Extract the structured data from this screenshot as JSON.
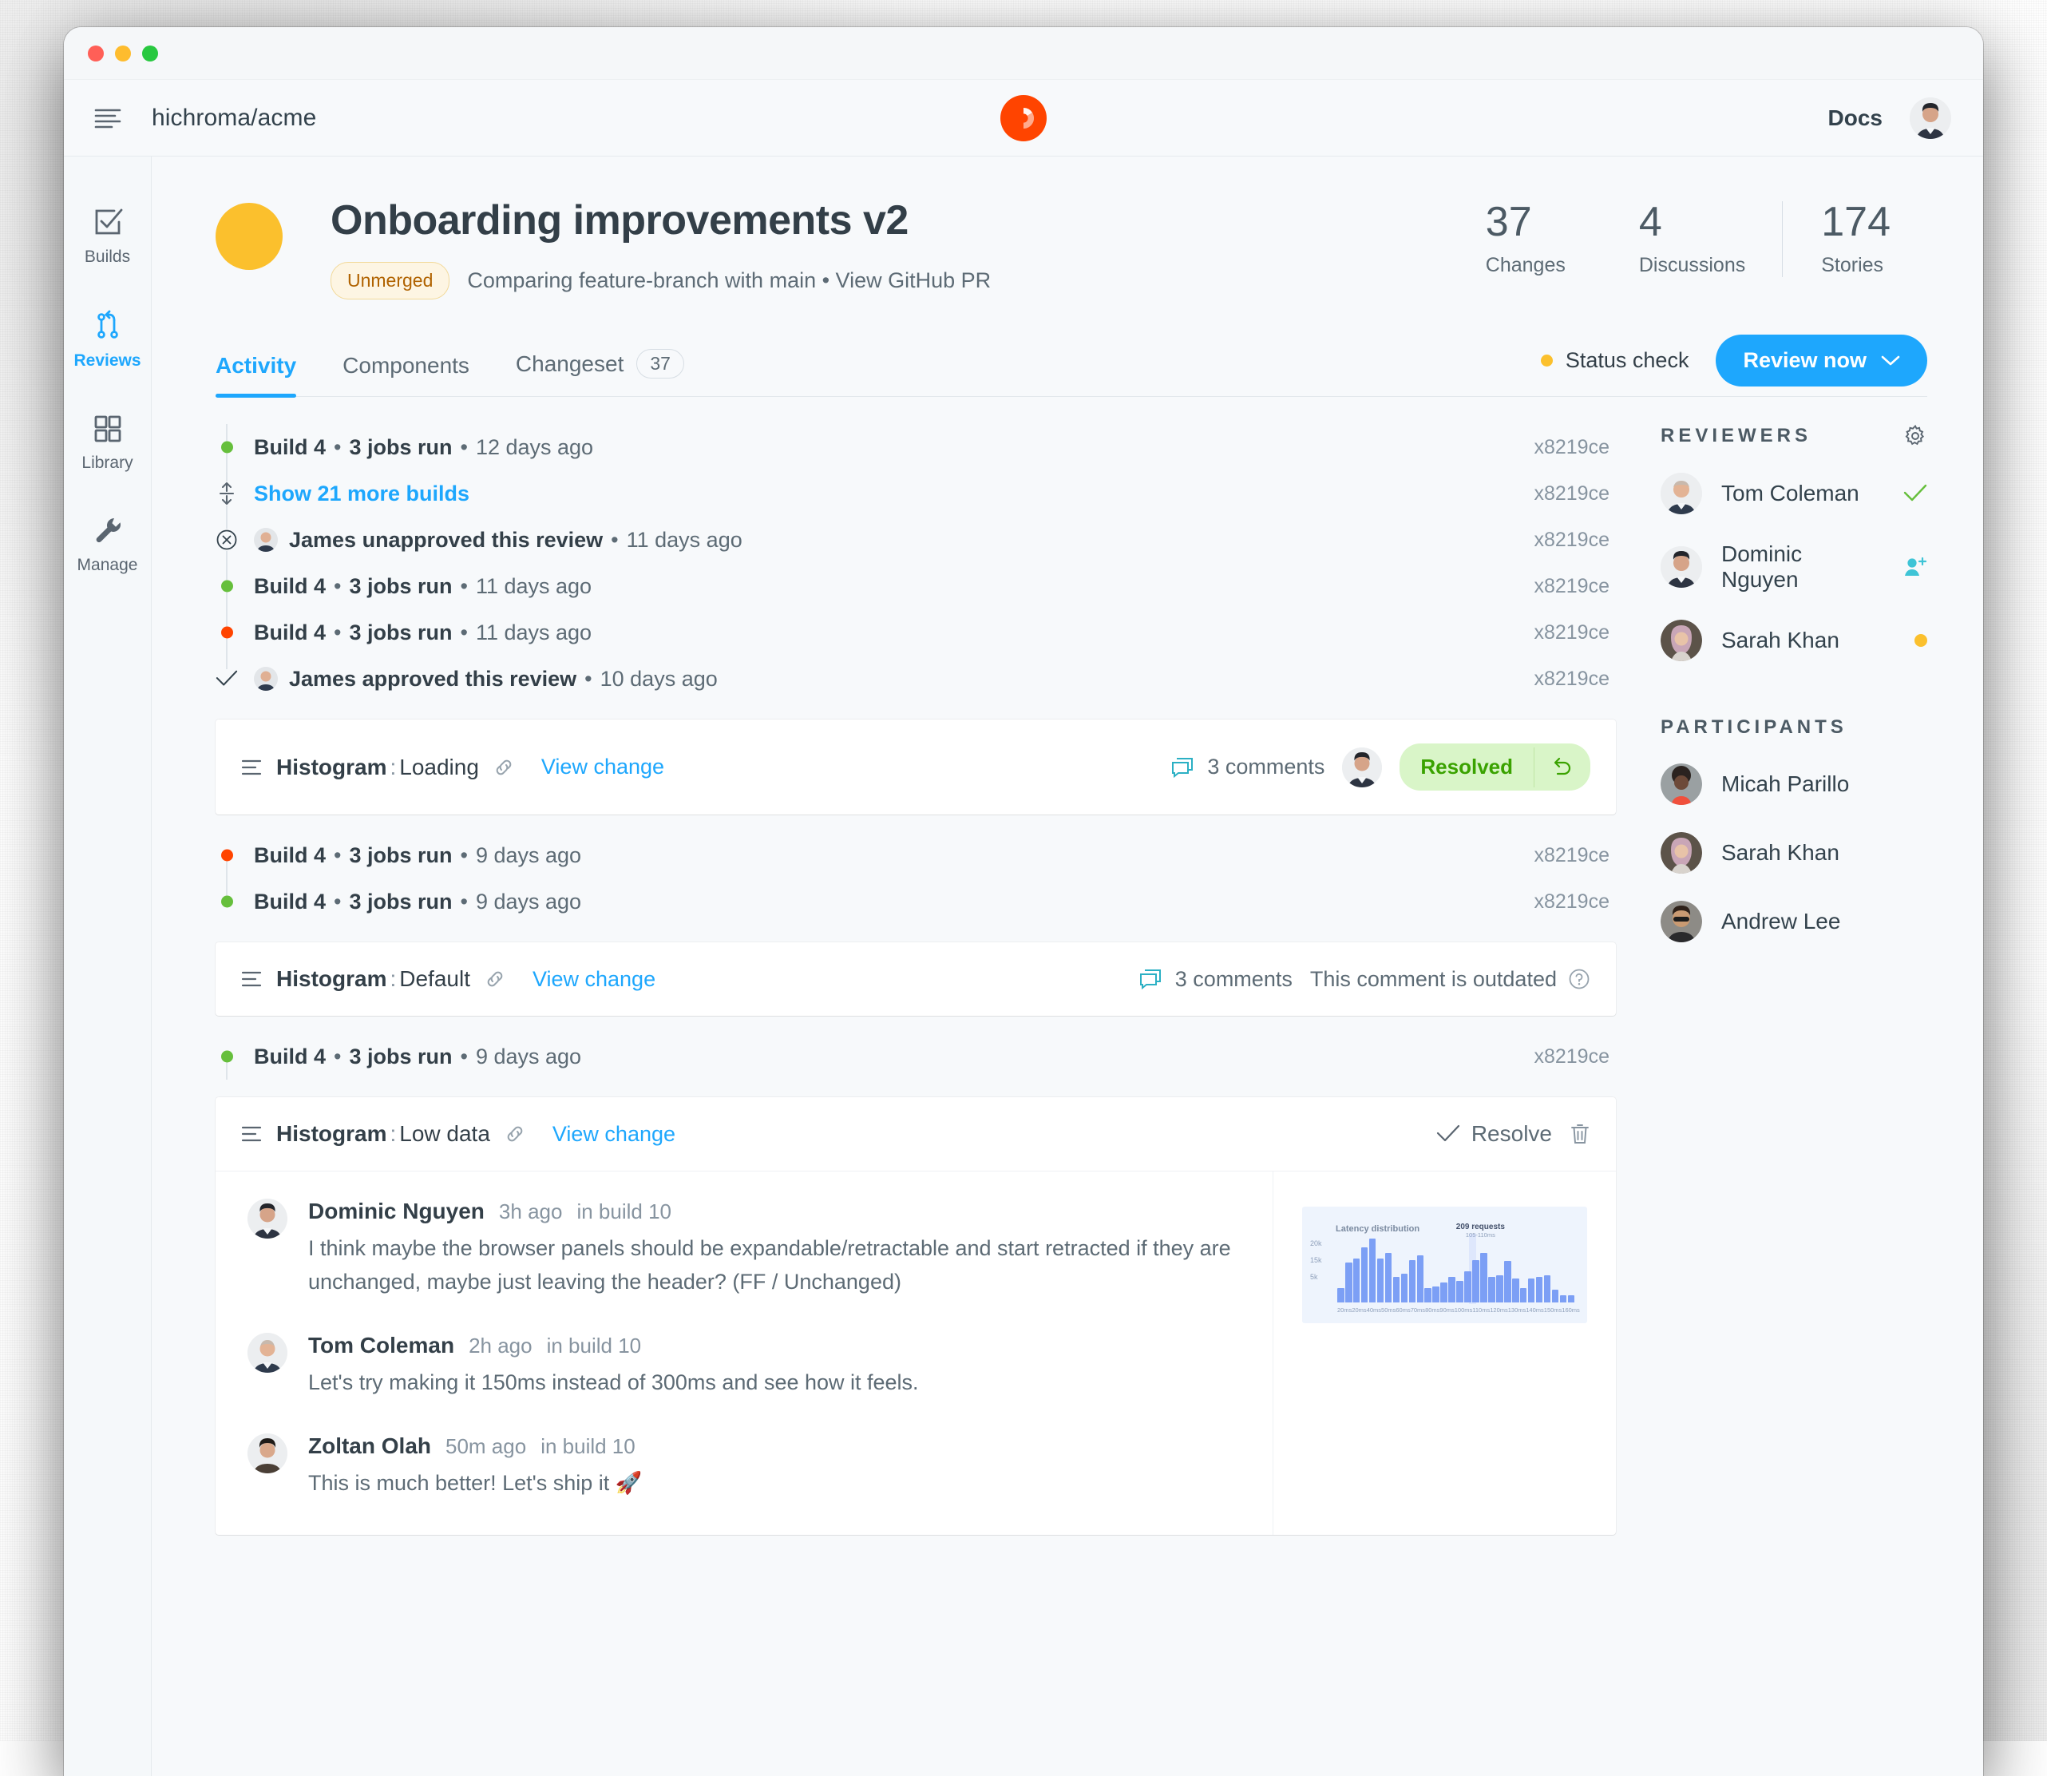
{
  "topnav": {
    "menu_icon": "hamburger-icon",
    "repo": "hichroma/acme",
    "logo": "chromatic-logo",
    "docs_label": "Docs",
    "user_avatar": "user-avatar"
  },
  "rail": {
    "items": [
      {
        "label": "Builds",
        "icon": "checkbox-check-icon",
        "active": false
      },
      {
        "label": "Reviews",
        "icon": "branch-merge-icon",
        "active": true
      },
      {
        "label": "Library",
        "icon": "grid-squares-icon",
        "active": false
      },
      {
        "label": "Manage",
        "icon": "wrench-icon",
        "active": false
      }
    ]
  },
  "header": {
    "title": "Onboarding improvements v2",
    "badge": "Unmerged",
    "subtitle": "Comparing feature-branch with main • View GitHub PR",
    "stats": [
      {
        "num": "37",
        "label": "Changes"
      },
      {
        "num": "4",
        "label": "Discussions"
      },
      {
        "num": "174",
        "label": "Stories"
      }
    ]
  },
  "tabs": {
    "items": [
      {
        "label": "Activity",
        "count": "",
        "active": true
      },
      {
        "label": "Components",
        "count": "",
        "active": false
      },
      {
        "label": "Changeset",
        "count": "37",
        "active": false
      }
    ],
    "status_check": "Status check",
    "review_button": "Review now"
  },
  "feed": [
    {
      "kind": "build",
      "dot": "green",
      "bold": "Build 4",
      "mid": "3 jobs run",
      "time": "12 days ago",
      "hash": "x8219ce"
    },
    {
      "kind": "more",
      "link": "Show 21 more builds",
      "icon": "expand-vertical-icon",
      "hash": "x8219ce"
    },
    {
      "kind": "review",
      "icon": "circle-x-icon",
      "avatar": "james-avatar",
      "bold": "James unapproved this review",
      "time": "11 days ago",
      "hash": "x8219ce"
    },
    {
      "kind": "build",
      "dot": "green",
      "bold": "Build 4",
      "mid": "3 jobs run",
      "time": "11 days ago",
      "hash": "x8219ce"
    },
    {
      "kind": "build",
      "dot": "red",
      "bold": "Build 4",
      "mid": "3 jobs run",
      "time": "11 days ago",
      "hash": "x8219ce"
    },
    {
      "kind": "review",
      "icon": "check-icon",
      "avatar": "james-avatar",
      "bold": "James approved this review",
      "time": "10 days ago",
      "hash": "x8219ce"
    }
  ],
  "feed2": [
    {
      "kind": "build",
      "dot": "red",
      "bold": "Build 4",
      "mid": "3 jobs run",
      "time": "9 days ago",
      "hash": "x8219ce"
    },
    {
      "kind": "build",
      "dot": "green",
      "bold": "Build 4",
      "mid": "3 jobs run",
      "time": "9 days ago",
      "hash": "x8219ce"
    }
  ],
  "feed3": [
    {
      "kind": "build",
      "dot": "green",
      "bold": "Build 4",
      "mid": "3 jobs run",
      "time": "9 days ago",
      "hash": "x8219ce"
    }
  ],
  "cards": {
    "loading": {
      "component": "Histogram",
      "variant": "Loading",
      "link_icon": "link-icon",
      "view_change": "View change",
      "comments": "3 comments",
      "comment_icon": "comment-icon",
      "avatar": "dominic-avatar",
      "resolved_label": "Resolved",
      "undo_icon": "undo-icon"
    },
    "default": {
      "component": "Histogram",
      "variant": "Default",
      "link_icon": "link-icon",
      "view_change": "View change",
      "comments": "3 comments",
      "comment_icon": "comment-icon",
      "outdated": "This comment is outdated",
      "help_icon": "question-circle-icon"
    },
    "lowdata": {
      "component": "Histogram",
      "variant": "Low data",
      "link_icon": "link-icon",
      "view_change": "View change",
      "resolve_label": "Resolve",
      "check_icon": "check-icon",
      "trash_icon": "trash-icon"
    }
  },
  "thread": [
    {
      "name": "Dominic Nguyen",
      "time": "3h ago",
      "build": "in build 10",
      "text": "I think maybe the browser panels should be expandable/retractable and start retracted if they are unchanged, maybe just leaving the header? (FF / Unchanged)"
    },
    {
      "name": "Tom Coleman",
      "time": "2h ago",
      "build": "in build 10",
      "text": "Let's try making it 150ms instead of 300ms and see how it feels."
    },
    {
      "name": "Zoltan Olah",
      "time": "50m ago",
      "build": "in build 10",
      "text": "This is much better! Let's ship it 🚀"
    }
  ],
  "sidebar": {
    "reviewers_title": "REVIEWERS",
    "gear_icon": "gear-icon",
    "reviewers": [
      {
        "name": "Tom Coleman",
        "status": "approved",
        "status_icon": "check-icon"
      },
      {
        "name": "Dominic Nguyen",
        "status": "invited",
        "status_icon": "user-plus-icon"
      },
      {
        "name": "Sarah Khan",
        "status": "pending",
        "status_icon": "dot-icon"
      }
    ],
    "participants_title": "PARTICIPANTS",
    "participants": [
      {
        "name": "Micah Parillo"
      },
      {
        "name": "Sarah Khan"
      },
      {
        "name": "Andrew Lee"
      }
    ]
  },
  "chart_data": {
    "type": "bar",
    "title": "Latency distribution",
    "xlabel": "",
    "ylabel": "",
    "ylim": [
      0,
      25000
    ],
    "ytick_labels": [
      "20k",
      "15k",
      "5k"
    ],
    "categories": [
      "20ms",
      "20ms",
      "",
      "40ms",
      "",
      "50ms",
      "",
      "60ms",
      "",
      "70ms",
      "",
      "80ms",
      "",
      "90ms",
      "",
      "100ms",
      "",
      "110ms",
      "",
      "120ms",
      "",
      "130ms",
      "",
      "140ms",
      "",
      "150ms",
      "",
      "160ms"
    ],
    "xtick_labels": [
      "20ms",
      "20ms",
      "40ms",
      "50ms",
      "60ms",
      "70ms",
      "80ms",
      "90ms",
      "100ms",
      "110ms",
      "120ms",
      "130ms",
      "140ms",
      "150ms",
      "160ms"
    ],
    "values": [
      5,
      14,
      15.5,
      19.5,
      22.5,
      15.5,
      17.5,
      9,
      10,
      15,
      16.5,
      5,
      5.5,
      7,
      9,
      7.5,
      11,
      15,
      17.5,
      9,
      9.5,
      14.5,
      8.5,
      5,
      8.5,
      9,
      9.5,
      4.5,
      2.5,
      2.5
    ],
    "annotation": {
      "label": "209 requests",
      "sub": "105-110ms"
    },
    "grid": false,
    "legend": null
  }
}
